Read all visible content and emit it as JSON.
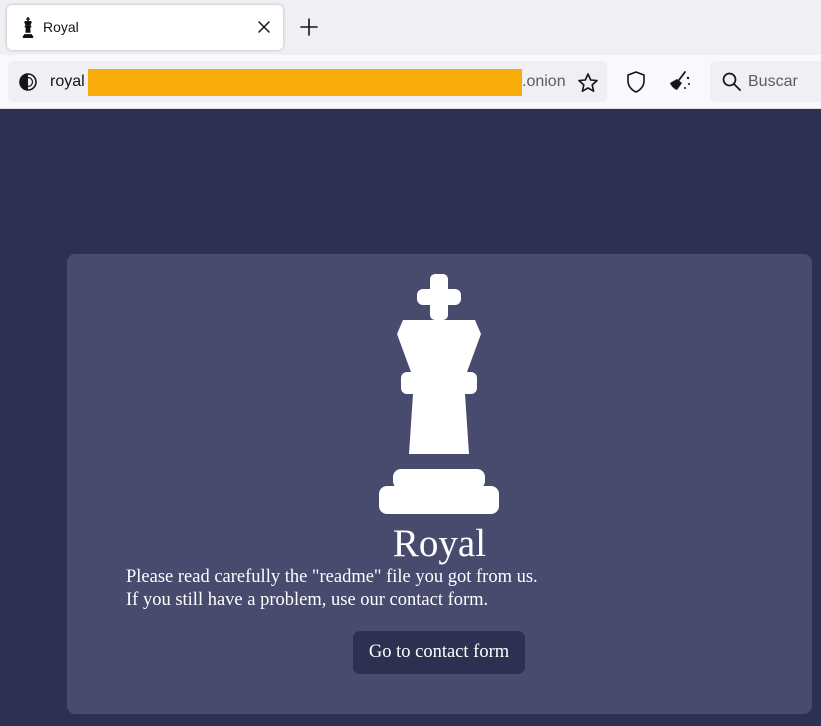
{
  "browser": {
    "tab": {
      "title": "Royal",
      "favicon": "chess-king-icon"
    },
    "new_tab_icon": "plus-icon",
    "close_icon": "close-icon",
    "address": {
      "prefix": "royal",
      "suffix": ".onion",
      "redacted": true,
      "redaction_color": "#f8ab0a"
    },
    "search": {
      "placeholder": "Buscar"
    },
    "toolbar_icons": [
      "onion-icon",
      "star-icon",
      "shield-icon",
      "broom-icon",
      "search-icon"
    ]
  },
  "page": {
    "background_color": "#2d3050",
    "card_color": "#484b6e",
    "logo_icon": "chess-king-icon",
    "title": "Royal",
    "message_lines": [
      "Please read carefully the \"readme\" file you got from us.",
      "If you still have a problem, use our contact form."
    ],
    "contact_button_label": "Go to contact form"
  }
}
